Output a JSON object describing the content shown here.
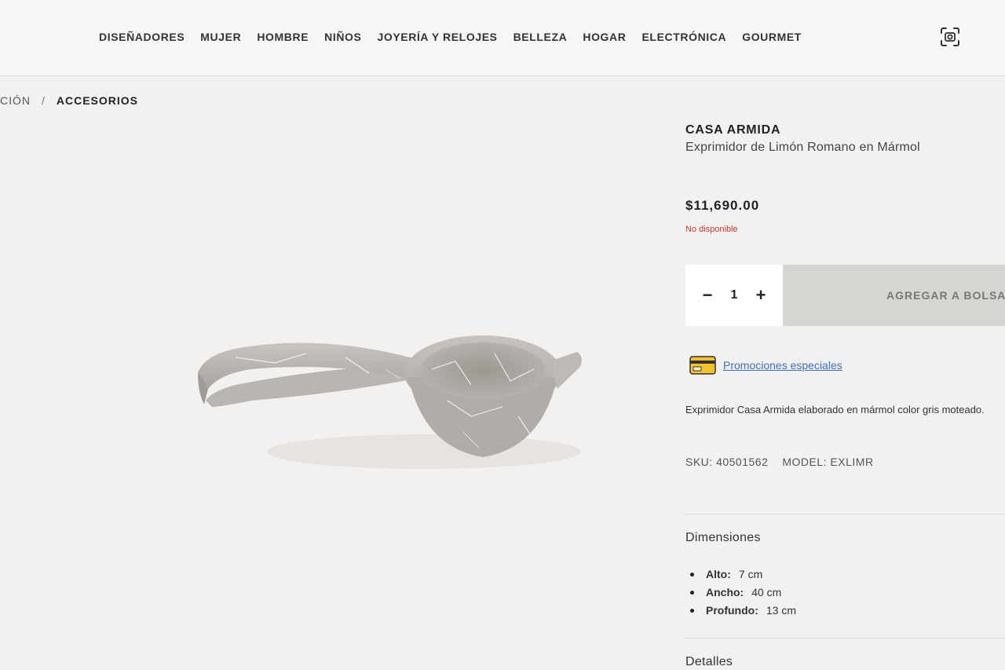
{
  "nav": {
    "items": [
      "DISEÑADORES",
      "MUJER",
      "HOMBRE",
      "NIÑOS",
      "JOYERÍA Y RELOJES",
      "BELLEZA",
      "HOGAR",
      "ELECTRÓNICA",
      "GOURMET"
    ],
    "scan_icon": "scan-icon"
  },
  "breadcrumb": {
    "previous": "CIÓN",
    "separator": "/",
    "current": "ACCESORIOS"
  },
  "product": {
    "brand": "CASA ARMIDA",
    "name": "Exprimidor de Limón Romano en Mármol",
    "price": "$11,690.00",
    "availability": "No disponible",
    "quantity": "1",
    "minus": "−",
    "plus": "+",
    "add_to_bag": "AGREGAR A BOLSA",
    "promo_link": "Promociones especiales",
    "description": "Exprimidor Casa Armida elaborado en mármol color gris moteado.",
    "sku": "SKU: 40501562",
    "model": "MODEL: EXLIMR",
    "dimensions_title": "Dimensiones",
    "dimensions": [
      {
        "label": "Alto:",
        "value": "7 cm"
      },
      {
        "label": "Ancho:",
        "value": "40 cm"
      },
      {
        "label": "Profundo:",
        "value": "13 cm"
      }
    ],
    "details_title": "Detalles"
  },
  "colors": {
    "background": "#f2f1ef",
    "unavailable": "#c0392b",
    "link": "#3b6fc4",
    "disabled_button": "#d6d5d2"
  }
}
